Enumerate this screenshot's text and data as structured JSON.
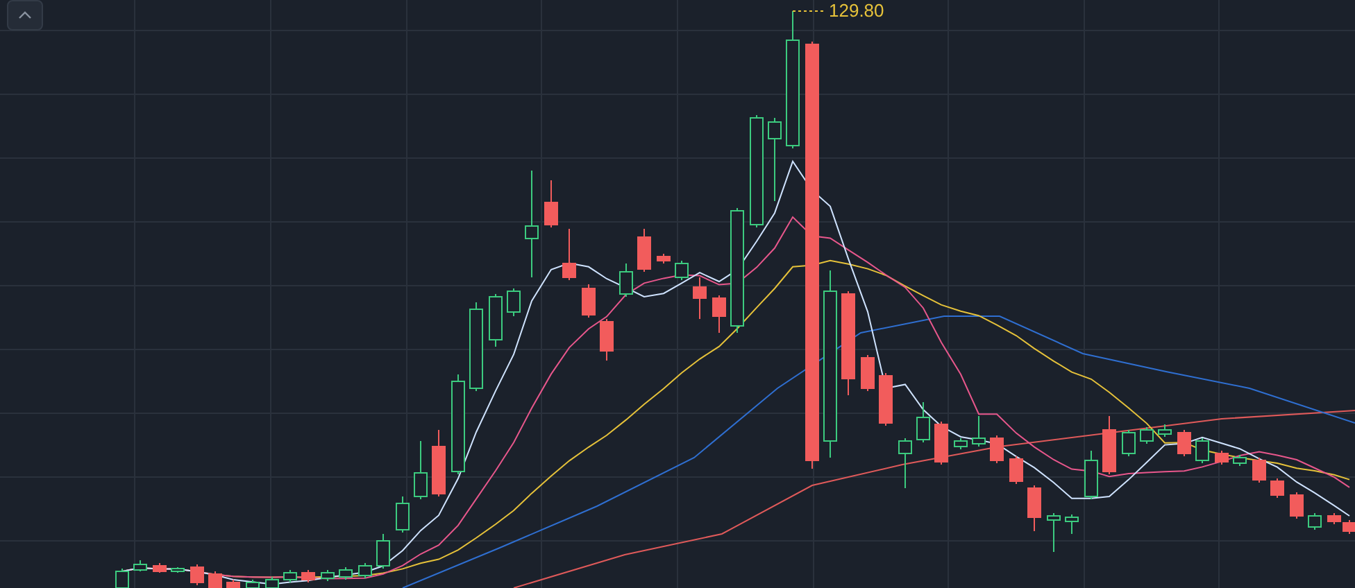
{
  "chart": {
    "high_price_label": "129.80"
  }
}
